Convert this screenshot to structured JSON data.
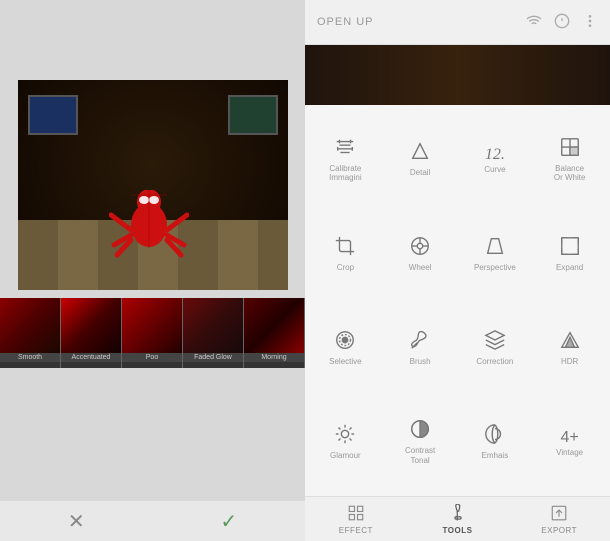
{
  "leftPanel": {
    "thumbnails": [
      {
        "label": "Smooth"
      },
      {
        "label": "Accentuated"
      },
      {
        "label": "Poo"
      },
      {
        "label": "Faded Glow"
      },
      {
        "label": "Morning"
      }
    ],
    "cancelLabel": "✕",
    "confirmLabel": "✓"
  },
  "rightPanel": {
    "header": {
      "title": "OPEN UP",
      "icons": [
        "wifi",
        "info",
        "menu"
      ]
    },
    "tools": [
      {
        "id": "calibrate",
        "label": "Calibrate\nImmagini",
        "icon": "calibrate"
      },
      {
        "id": "detail",
        "label": "Detail",
        "icon": "detail"
      },
      {
        "id": "curve",
        "label": "Curve",
        "icon": "curve"
      },
      {
        "id": "balance",
        "label": "Balance\nOr White",
        "icon": "balance"
      },
      {
        "id": "crop",
        "label": "Crop",
        "icon": "crop"
      },
      {
        "id": "wheel",
        "label": "Wheel",
        "icon": "wheel"
      },
      {
        "id": "perspective",
        "label": "Perspective",
        "icon": "perspective"
      },
      {
        "id": "expand",
        "label": "Expand",
        "icon": "expand"
      },
      {
        "id": "selective",
        "label": "Selective",
        "icon": "selective"
      },
      {
        "id": "brush",
        "label": "Brush",
        "icon": "brush"
      },
      {
        "id": "correction",
        "label": "Correction",
        "icon": "correction"
      },
      {
        "id": "hdr",
        "label": "HDR",
        "icon": "hdr"
      },
      {
        "id": "glamour",
        "label": "Glamour",
        "icon": "glamour"
      },
      {
        "id": "contrasttonal",
        "label": "Contrast\nTonal",
        "icon": "contrasttonal"
      },
      {
        "id": "emhais",
        "label": "Emhais",
        "icon": "emhais"
      },
      {
        "id": "vintage",
        "label": "Vintage",
        "icon": "vintage"
      }
    ],
    "bottomNav": [
      {
        "id": "effect",
        "label": "EFFECT",
        "icon": "effect"
      },
      {
        "id": "tools",
        "label": "TOOLS",
        "icon": "tools",
        "active": true
      },
      {
        "id": "export",
        "label": "EXPORT",
        "icon": "export"
      }
    ]
  }
}
